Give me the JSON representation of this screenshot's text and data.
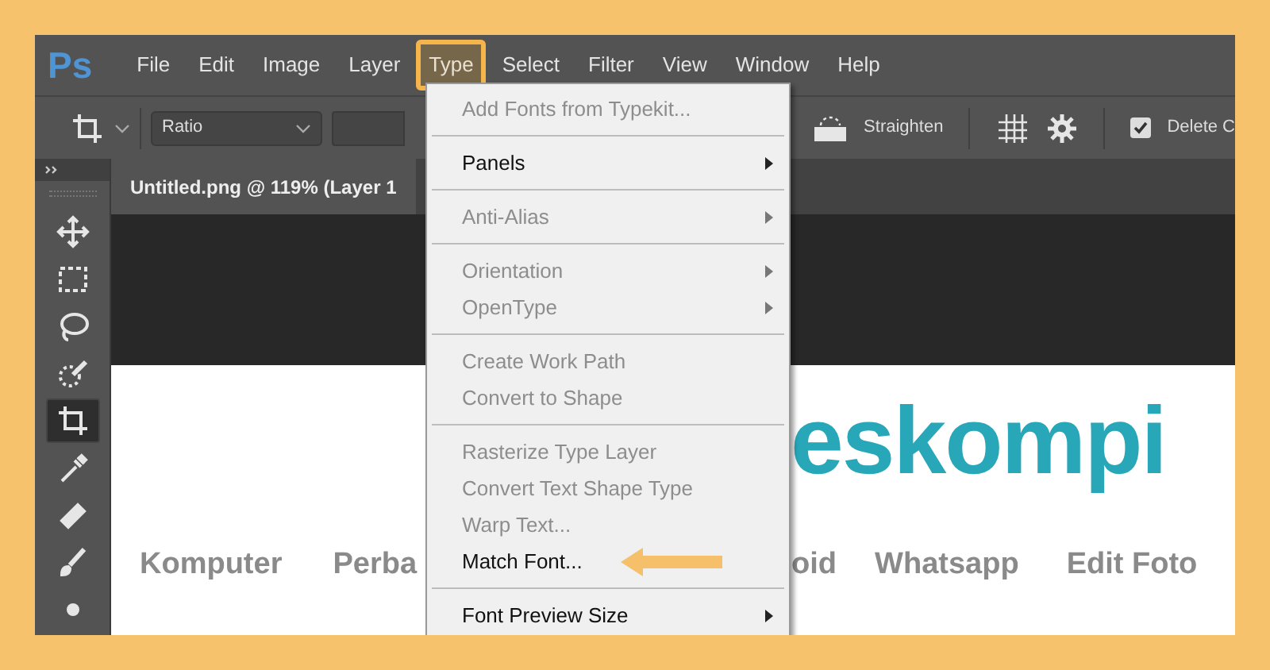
{
  "app": {
    "logo": "Ps"
  },
  "menubar": [
    {
      "label": "File",
      "selected": false
    },
    {
      "label": "Edit",
      "selected": false
    },
    {
      "label": "Image",
      "selected": false
    },
    {
      "label": "Layer",
      "selected": false
    },
    {
      "label": "Type",
      "selected": true
    },
    {
      "label": "Select",
      "selected": false
    },
    {
      "label": "Filter",
      "selected": false
    },
    {
      "label": "View",
      "selected": false
    },
    {
      "label": "Window",
      "selected": false
    },
    {
      "label": "Help",
      "selected": false
    }
  ],
  "toolbar": {
    "ratio_select": "Ratio",
    "straighten_label": "Straighten",
    "delete_checkbox": {
      "label": "Delete C",
      "checked": true
    }
  },
  "document_tab": "Untitled.png @ 119% (Layer 1",
  "tools": [
    {
      "kind": "move",
      "selected": false
    },
    {
      "kind": "marquee",
      "selected": false
    },
    {
      "kind": "lasso",
      "selected": false
    },
    {
      "kind": "quick-select",
      "selected": false
    },
    {
      "kind": "crop",
      "selected": true
    },
    {
      "kind": "eyedropper",
      "selected": false
    },
    {
      "kind": "healing",
      "selected": false
    },
    {
      "kind": "brush",
      "selected": false
    },
    {
      "kind": "stamp",
      "selected": false
    }
  ],
  "canvas": {
    "logo_text": "eskompi",
    "nav": [
      "Komputer",
      "Perba",
      "oid",
      "Whatsapp",
      "Edit Foto"
    ]
  },
  "type_menu": {
    "groups": [
      [
        {
          "label": "Add Fonts from Typekit...",
          "disabled": true,
          "submenu": false
        }
      ],
      [
        {
          "label": "Panels",
          "disabled": false,
          "submenu": true
        }
      ],
      [
        {
          "label": "Anti-Alias",
          "disabled": true,
          "submenu": true
        }
      ],
      [
        {
          "label": "Orientation",
          "disabled": true,
          "submenu": true
        },
        {
          "label": "OpenType",
          "disabled": true,
          "submenu": true
        }
      ],
      [
        {
          "label": "Create Work Path",
          "disabled": true,
          "submenu": false
        },
        {
          "label": "Convert to Shape",
          "disabled": true,
          "submenu": false
        }
      ],
      [
        {
          "label": "Rasterize Type Layer",
          "disabled": true,
          "submenu": false
        },
        {
          "label": "Convert Text Shape Type",
          "disabled": true,
          "submenu": false
        },
        {
          "label": "Warp Text...",
          "disabled": true,
          "submenu": false
        },
        {
          "label": "Match Font...",
          "disabled": false,
          "submenu": false,
          "pointed": true
        }
      ],
      [
        {
          "label": "Font Preview Size",
          "disabled": false,
          "submenu": true
        }
      ]
    ]
  }
}
